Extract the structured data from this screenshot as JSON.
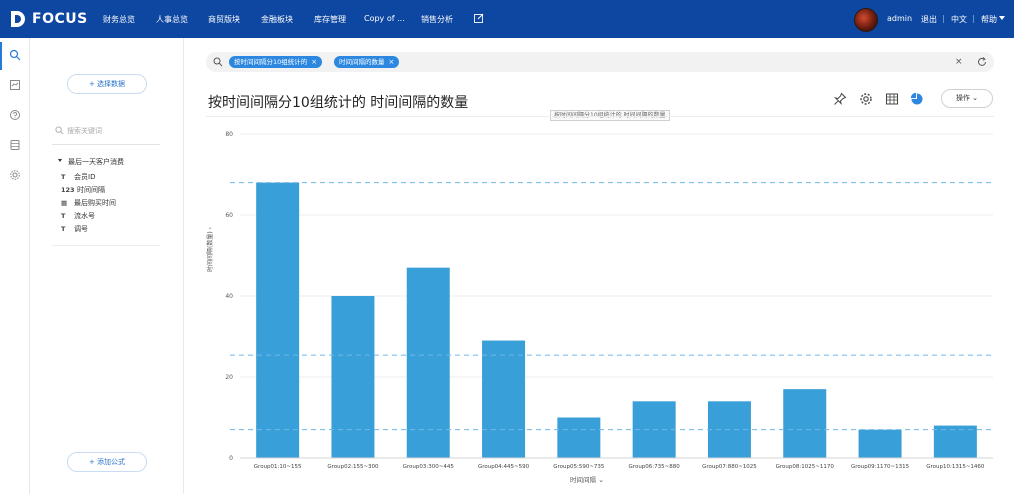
{
  "app": {
    "logo_text": "FOCUS",
    "nav": [
      "财务总览",
      "人事总览",
      "商贸版块",
      "金融板块",
      "库存管理",
      "Copy of ...",
      "销售分析"
    ],
    "user": "admin",
    "logout": "退出",
    "language": "中文",
    "help": "帮助"
  },
  "sidebar": {
    "select_data_label": "+ 选择数据",
    "search_placeholder": "搜索关键词",
    "table_name": "最后一天客户消费",
    "fields": [
      {
        "type": "T",
        "name": "会员ID"
      },
      {
        "type": "123",
        "name": "时间间隔"
      },
      {
        "type": "cal",
        "name": "最后购买时间"
      },
      {
        "type": "T",
        "name": "流水号"
      },
      {
        "type": "T",
        "name": "调号"
      }
    ],
    "add_formula_label": "+ 添加公式"
  },
  "query": {
    "chips": [
      "按时间间隔分10组统计的",
      "时间间隔的数量"
    ],
    "clear_symbol": "×"
  },
  "title": "按时间间隔分10组统计的 时间间隔的数量",
  "tooltip": "按时间间隔分10组统计的 时间间隔的数量",
  "toolbar": {
    "ops_label": "操作"
  },
  "colors": {
    "bar": "#399fd9",
    "topbar": "#0d47a1",
    "accent": "#2b87e0",
    "ref_line": "#6fb8e6"
  },
  "chart_data": {
    "type": "bar",
    "categories": [
      "Group01:10~155",
      "Group02:155~300",
      "Group03:300~445",
      "Group04:445~590",
      "Group05:590~735",
      "Group06:735~880",
      "Group07:880~1025",
      "Group08:1025~1170",
      "Group09:1170~1315",
      "Group10:1315~1460"
    ],
    "values": [
      68,
      40,
      47,
      29,
      10,
      14,
      14,
      17,
      7,
      8
    ],
    "xlabel": "时间间隔",
    "ylabel": "时间间隔(数量)",
    "ylim": [
      0,
      80
    ],
    "yticks": [
      0,
      20,
      40,
      60,
      80
    ],
    "reference_lines": [
      68,
      25.4,
      7
    ],
    "grid": true
  }
}
